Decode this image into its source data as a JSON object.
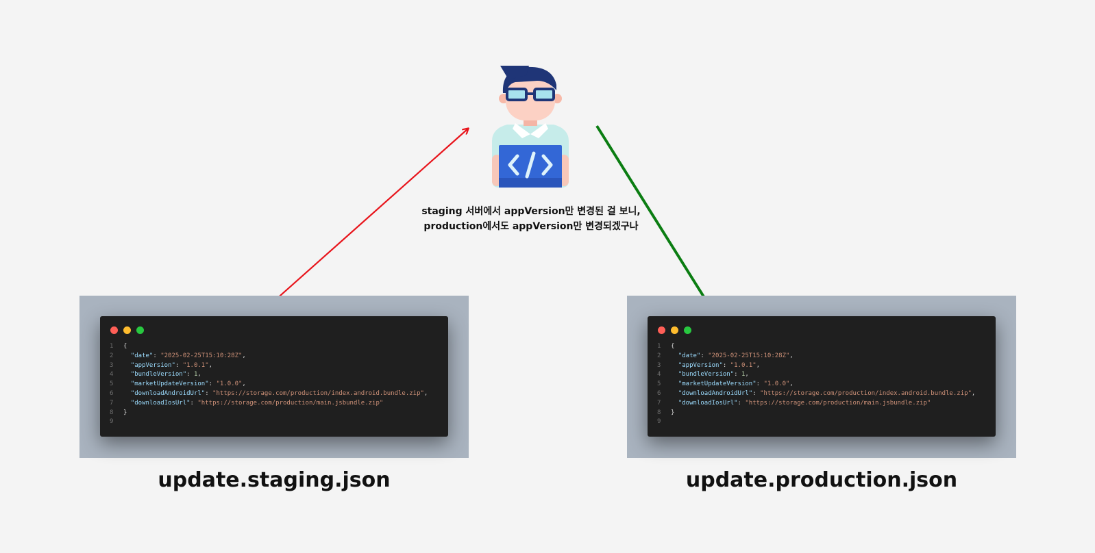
{
  "caption": {
    "line1": "staging 서버에서 appVersion만 변경된 걸 보니,",
    "line2": "production에서도 appVersion만 변경되겠구나"
  },
  "developer_icon": "developer-coding-icon",
  "files": {
    "staging": {
      "title": "update.staging.json",
      "lines": [
        {
          "n": "1",
          "open": "{"
        },
        {
          "n": "2",
          "key": "\"date\"",
          "sep": ": ",
          "val": "\"2025-02-25T15:10:28Z\"",
          "tail": ","
        },
        {
          "n": "3",
          "key": "\"appVersion\"",
          "sep": ": ",
          "val": "\"1.0.1\"",
          "tail": ","
        },
        {
          "n": "4",
          "key": "\"bundleVersion\"",
          "sep": ": ",
          "val": "1",
          "tail": ","
        },
        {
          "n": "5",
          "key": "\"marketUpdateVersion\"",
          "sep": ": ",
          "val": "\"1.0.0\"",
          "tail": ","
        },
        {
          "n": "6",
          "key": "\"downloadAndroidUrl\"",
          "sep": ": ",
          "val": "\"https://storage.com/production/index.android.bundle.zip\"",
          "tail": ","
        },
        {
          "n": "7",
          "key": "\"downloadIosUrl\"",
          "sep": ": ",
          "val": "\"https://storage.com/production/main.jsbundle.zip\"",
          "tail": ""
        },
        {
          "n": "8",
          "open": "}"
        },
        {
          "n": "9",
          "open": ""
        }
      ]
    },
    "production": {
      "title": "update.production.json",
      "lines": [
        {
          "n": "1",
          "open": "{"
        },
        {
          "n": "2",
          "key": "\"date\"",
          "sep": ": ",
          "val": "\"2025-02-25T15:10:28Z\"",
          "tail": ","
        },
        {
          "n": "3",
          "key": "\"appVersion\"",
          "sep": ": ",
          "val": "\"1.0.1\"",
          "tail": ","
        },
        {
          "n": "4",
          "key": "\"bundleVersion\"",
          "sep": ": ",
          "val": "1",
          "tail": ","
        },
        {
          "n": "5",
          "key": "\"marketUpdateVersion\"",
          "sep": ": ",
          "val": "\"1.0.0\"",
          "tail": ","
        },
        {
          "n": "6",
          "key": "\"downloadAndroidUrl\"",
          "sep": ": ",
          "val": "\"https://storage.com/production/index.android.bundle.zip\"",
          "tail": ","
        },
        {
          "n": "7",
          "key": "\"downloadIosUrl\"",
          "sep": ": ",
          "val": "\"https://storage.com/production/main.jsbundle.zip\"",
          "tail": ""
        },
        {
          "n": "8",
          "open": "}"
        },
        {
          "n": "9",
          "open": ""
        }
      ]
    }
  },
  "colors": {
    "staging_arrow": "#e8141b",
    "production_arrow": "#0b7d12",
    "window_dot_red": "#ff5f57",
    "window_dot_yellow": "#febc2e",
    "window_dot_green": "#28c840"
  }
}
